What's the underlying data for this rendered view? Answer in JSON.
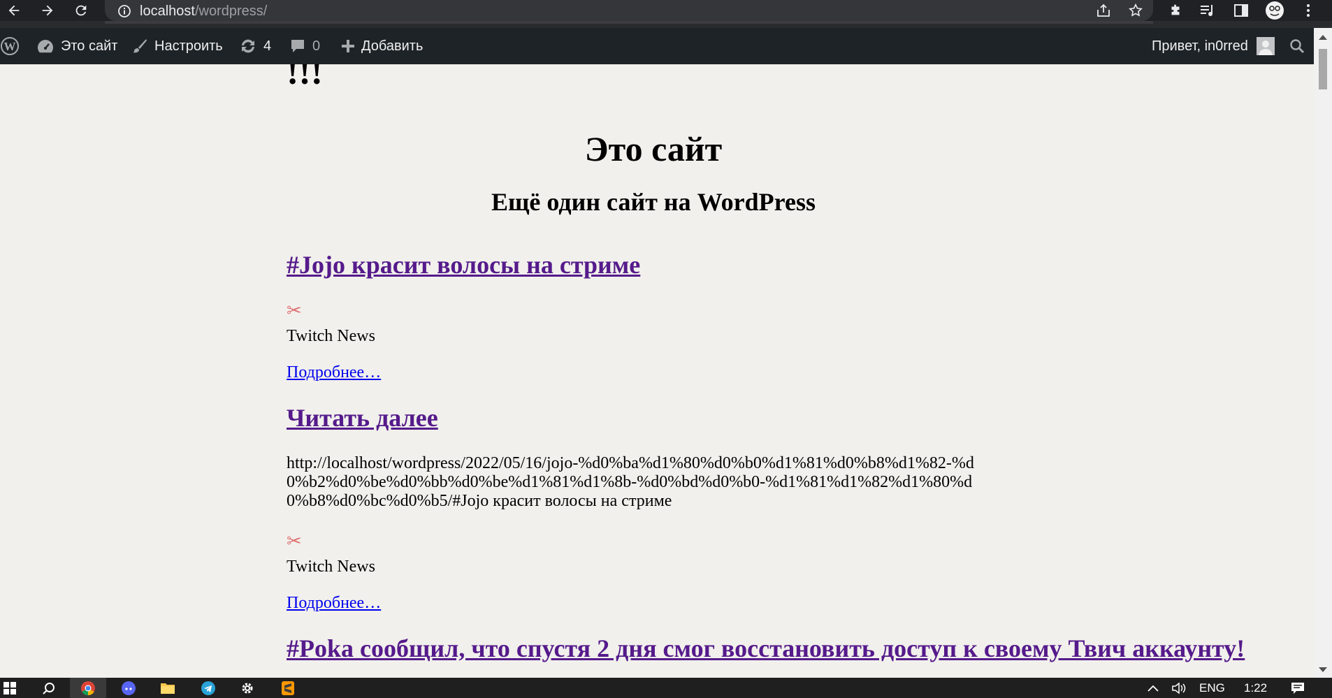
{
  "browser": {
    "url_host": "localhost",
    "url_path": "/wordpress/"
  },
  "adminbar": {
    "site_label": "Это сайт",
    "customize_label": "Настроить",
    "updates_count": "4",
    "comments_count": "0",
    "new_label": "Добавить",
    "greeting": "Привет, in0rred"
  },
  "page": {
    "exclamation": "!!!",
    "site_title": "Это сайт",
    "site_description": "Ещё один сайт на WordPress",
    "posts": [
      {
        "title": "#Jojo красит волосы на стриме ",
        "icon": "✂",
        "category": "Twitch News",
        "more": "Подробнее…"
      },
      {
        "title": "Читать далее",
        "text": "http://localhost/wordpress/2022/05/16/jojo-%d0%ba%d1%80%d0%b0%d1%81%d0%b8%d1%82-%d0%b2%d0%be%d0%bb%d0%be%d1%81%d1%8b-%d0%bd%d0%b0-%d1%81%d1%82%d1%80%d0%b8%d0%bc%d0%b5/#Jojo красит волосы на стриме",
        "icon": "✂",
        "category": "Twitch News",
        "more": "Подробнее…"
      },
      {
        "title": "#Poka сообщил, что спустя 2 дня смог восстановить доступ к своему Твич аккаунту!"
      }
    ]
  },
  "taskbar": {
    "language": "ENG",
    "time": "1:22"
  }
}
